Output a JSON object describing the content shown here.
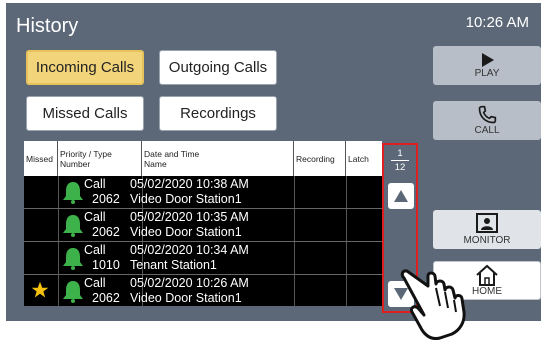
{
  "header": {
    "title": "History",
    "time": "10:26 AM"
  },
  "tabs": [
    {
      "label": "Incoming Calls",
      "active": true
    },
    {
      "label": "Outgoing Calls",
      "active": false
    },
    {
      "label": "Missed Calls",
      "active": false
    },
    {
      "label": "Recordings",
      "active": false
    }
  ],
  "table": {
    "columns": {
      "missed": "Missed",
      "priority_line1": "Priority / Type",
      "priority_line2": "Number",
      "date_line1": "Date and Time",
      "date_line2": "Name",
      "recording": "Recording",
      "latch": "Latch"
    },
    "rows": [
      {
        "type": "Call",
        "number": "2062",
        "datetime": "05/02/2020 10:38 AM",
        "name": "Video Door Station1",
        "starred": false
      },
      {
        "type": "Call",
        "number": "2062",
        "datetime": "05/02/2020 10:35 AM",
        "name": "Video Door Station1",
        "starred": false
      },
      {
        "type": "Call",
        "number": "1010",
        "datetime": "05/02/2020 10:34 AM",
        "name": "Tenant Station1",
        "starred": false
      },
      {
        "type": "Call",
        "number": "2062",
        "datetime": "05/02/2020 10:26 AM",
        "name": "Video Door Station1",
        "starred": true
      }
    ]
  },
  "pagination": {
    "current": "1",
    "total": "12"
  },
  "side_buttons": {
    "play": "PLAY",
    "call": "CALL",
    "monitor": "MONITOR",
    "home": "HOME"
  },
  "icons": {
    "bell": "bell-icon",
    "star": "star-icon",
    "up": "arrow-up-icon",
    "down": "arrow-down-icon",
    "play": "play-icon",
    "call": "phone-icon",
    "monitor": "monitor-icon",
    "home": "home-icon",
    "hand": "hand-pointer-icon"
  },
  "colors": {
    "background": "#5c6878",
    "active_tab": "#f2d47a",
    "bell": "#3db24a",
    "star": "#f4c20d",
    "highlight": "#e02020"
  }
}
